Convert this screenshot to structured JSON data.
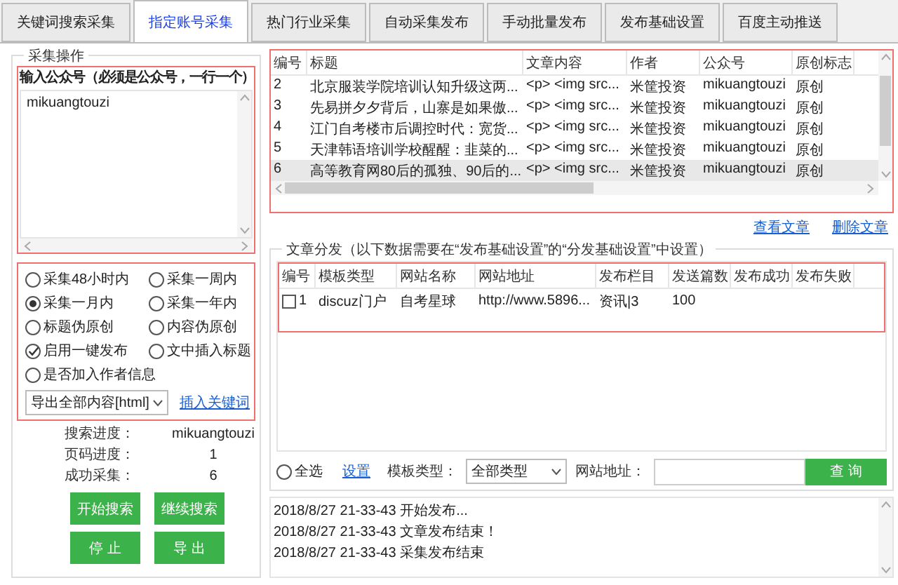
{
  "tabs": [
    {
      "label": "关键词搜索采集",
      "selected": false
    },
    {
      "label": "指定账号采集",
      "selected": true
    },
    {
      "label": "热门行业采集",
      "selected": false
    },
    {
      "label": "自动采集发布",
      "selected": false
    },
    {
      "label": "手动批量发布",
      "selected": false
    },
    {
      "label": "发布基础设置",
      "selected": false
    },
    {
      "label": "百度主动推送",
      "selected": false
    }
  ],
  "collect": {
    "group_title": "采集操作",
    "input_label": "输入公众号（必须是公众号，一行一个）",
    "input_value": "mikuangtouzi",
    "options": [
      {
        "kind": "radio",
        "label": "采集48小时内",
        "selected": false
      },
      {
        "kind": "radio",
        "label": "采集一周内",
        "selected": false
      },
      {
        "kind": "radio",
        "label": "采集一月内",
        "selected": true
      },
      {
        "kind": "radio",
        "label": "采集一年内",
        "selected": false
      },
      {
        "kind": "check",
        "label": "标题伪原创",
        "checked": false
      },
      {
        "kind": "check",
        "label": "内容伪原创",
        "checked": false
      },
      {
        "kind": "check",
        "label": "启用一键发布",
        "checked": true
      },
      {
        "kind": "check",
        "label": "文中插入标题",
        "checked": false
      },
      {
        "kind": "check",
        "label": "是否加入作者信息",
        "checked": false
      }
    ],
    "export_select": "导出全部内容[html]",
    "insert_link": "插入关键词",
    "progress": [
      {
        "label": "搜索进度：",
        "value": "mikuangtouzi"
      },
      {
        "label": "页码进度：",
        "value": "1"
      },
      {
        "label": "成功采集：",
        "value": "6"
      }
    ],
    "buttons": [
      "开始搜索",
      "继续搜索",
      "停 止",
      "导 出"
    ]
  },
  "articles": {
    "columns": [
      "编号",
      "标题",
      "文章内容",
      "作者",
      "公众号",
      "原创标志"
    ],
    "rows": [
      {
        "selected": false,
        "cells": [
          "2",
          "北京服装学院培训认知升级这两...",
          "<p> <img src...",
          "米筐投资",
          "mikuangtouzi",
          "原创"
        ]
      },
      {
        "selected": false,
        "cells": [
          "3",
          "先易拼夕夕背后，山寨是如果傲...",
          "<p> <img src...",
          "米筐投资",
          "mikuangtouzi",
          "原创"
        ]
      },
      {
        "selected": false,
        "cells": [
          "4",
          "江门自考楼市后调控时代：宽货...",
          "<p> <img src...",
          "米筐投资",
          "mikuangtouzi",
          "原创"
        ]
      },
      {
        "selected": false,
        "cells": [
          "5",
          "天津韩语培训学校醒醒：韭菜的...",
          "<p> <img src...",
          "米筐投资",
          "mikuangtouzi",
          "原创"
        ]
      },
      {
        "selected": true,
        "cells": [
          "6",
          "高等教育网80后的孤独、90后的...",
          "<p> <img src...",
          "米筐投资",
          "mikuangtouzi",
          "原创"
        ]
      }
    ],
    "links": [
      "查看文章",
      "删除文章"
    ]
  },
  "distribution": {
    "title": "文章分发（以下数据需要在“发布基础设置”的“分发基础设置”中设置）",
    "columns": [
      "编号",
      "模板类型",
      "网站名称",
      "网站地址",
      "发布栏目",
      "发送篇数",
      "发布成功",
      "发布失败"
    ],
    "rows": [
      {
        "checked": false,
        "cells": [
          "1",
          "discuz门户",
          "自考星球",
          "http://www.5896...",
          "资讯|3",
          "100",
          "",
          ""
        ]
      }
    ],
    "select_all": {
      "label": "全选",
      "checked": false
    },
    "settings_link": "设置",
    "template_label": "模板类型：",
    "template_value": "全部类型",
    "site_label": "网站地址：",
    "query_button": "查 询"
  },
  "log": [
    "2018/8/27 21-33-43 开始发布...",
    "2018/8/27 21-33-43 文章发布结束！",
    "2018/8/27 21-33-43 采集发布结束"
  ]
}
